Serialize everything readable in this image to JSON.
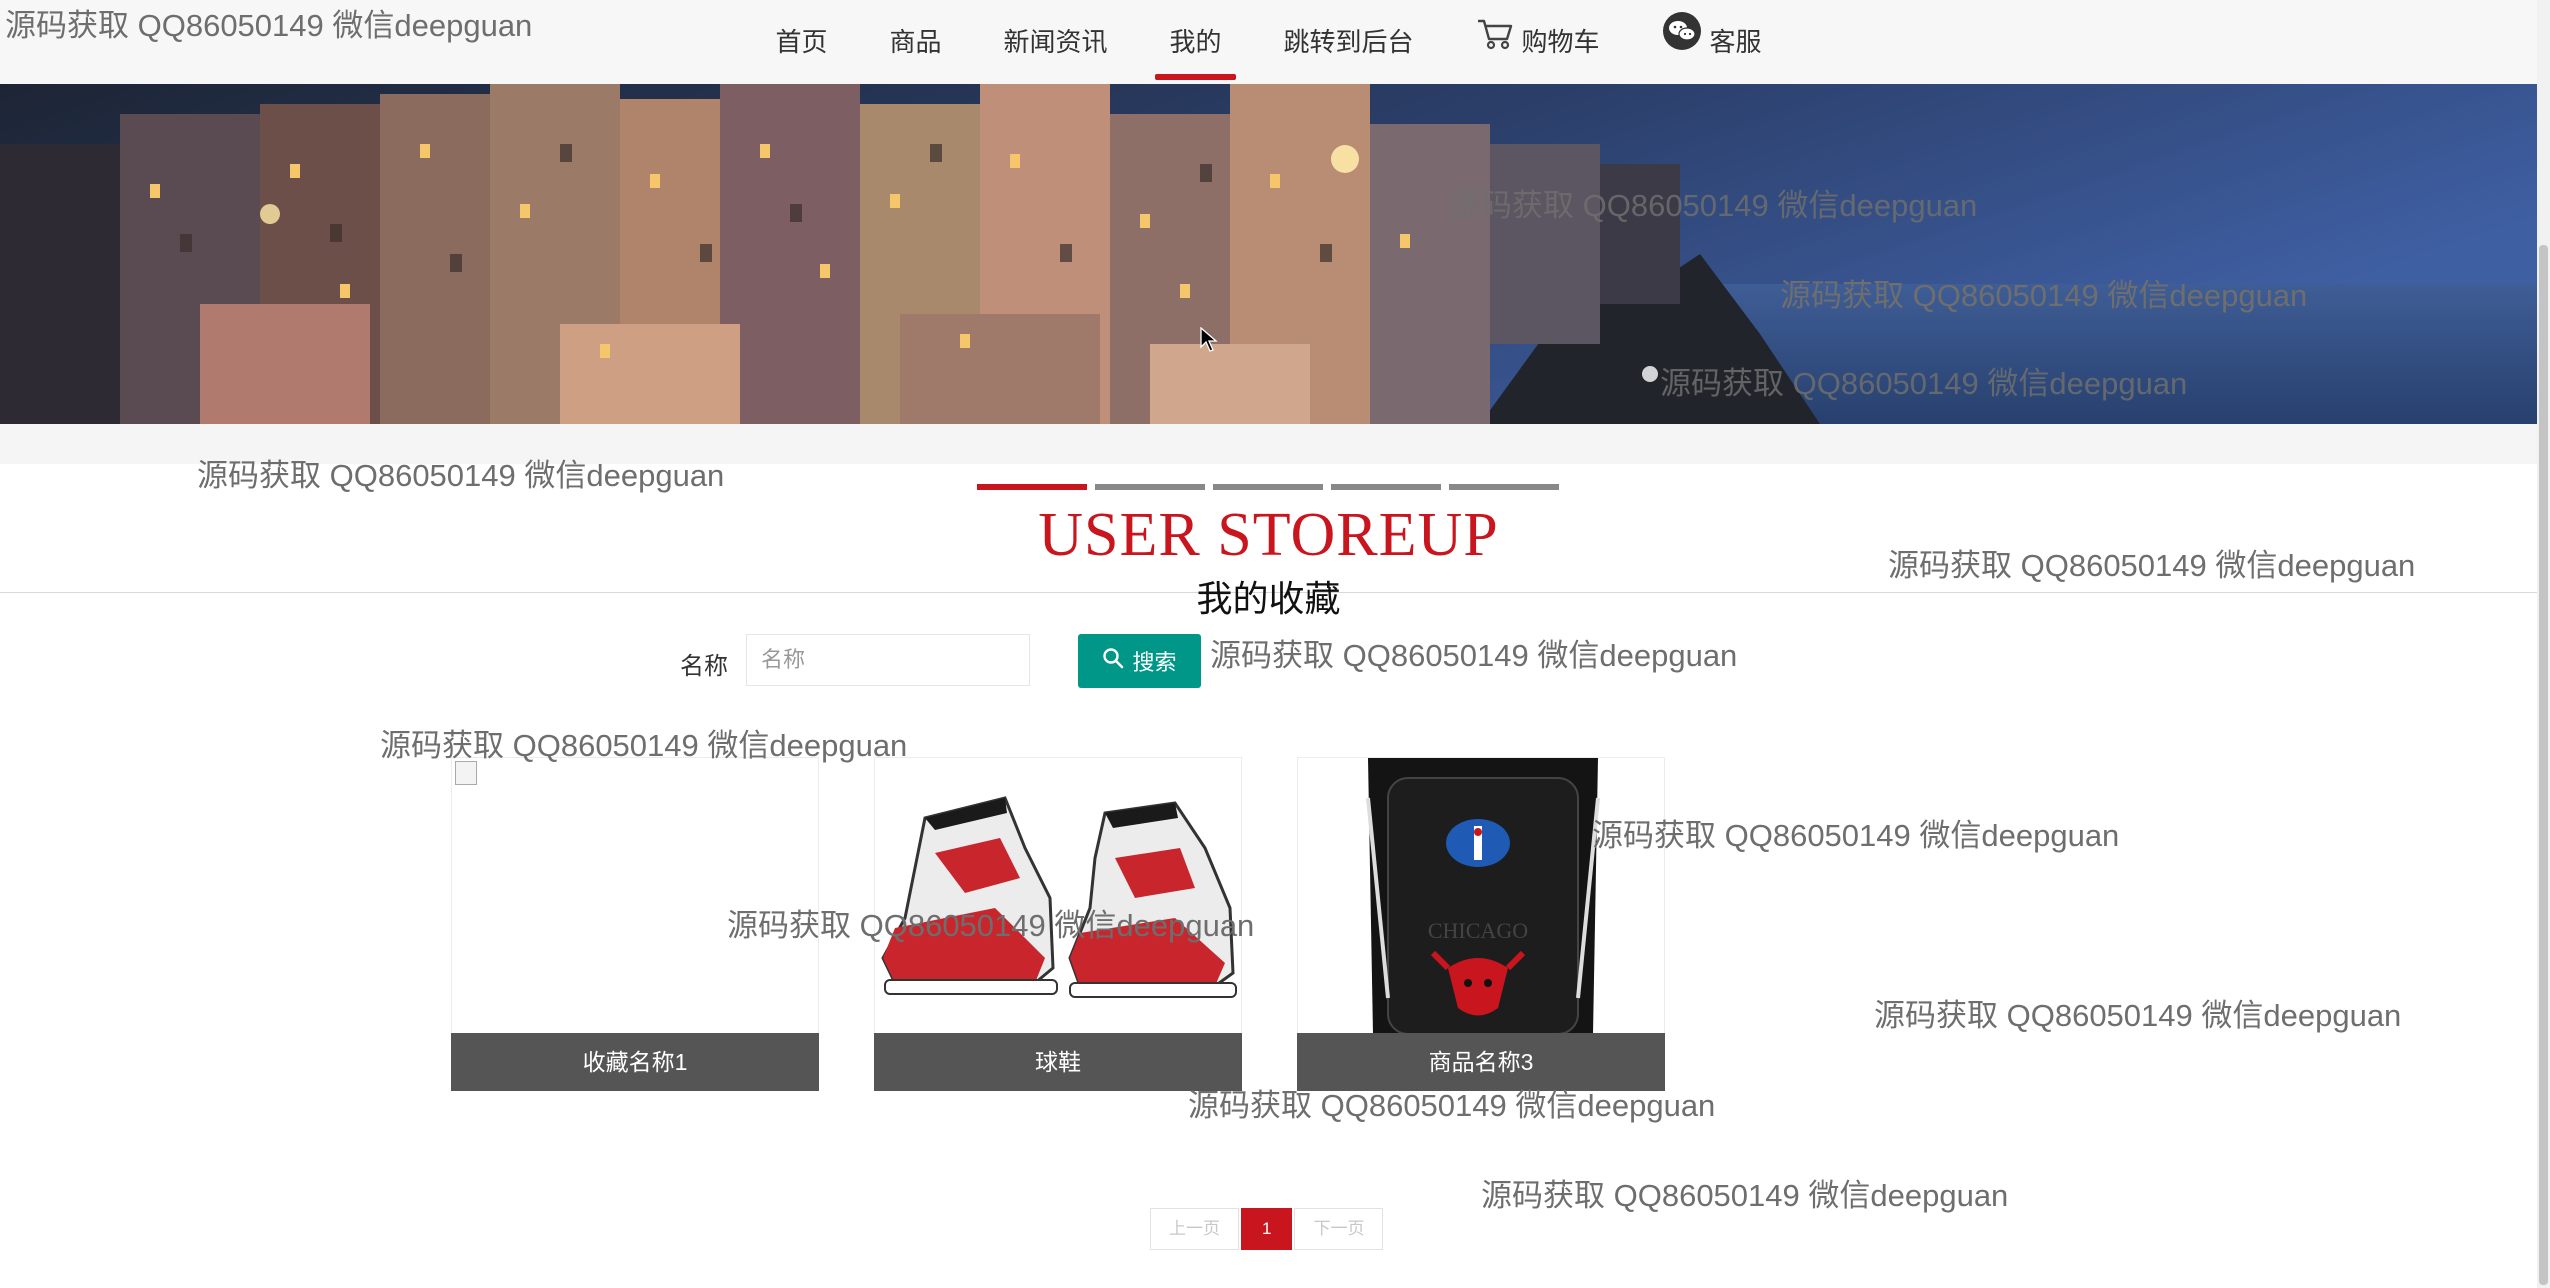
{
  "nav": {
    "items": [
      {
        "label": "首页",
        "icon": null,
        "active": false
      },
      {
        "label": "商品",
        "icon": null,
        "active": false
      },
      {
        "label": "新闻资讯",
        "icon": null,
        "active": false
      },
      {
        "label": "我的",
        "icon": null,
        "active": true
      },
      {
        "label": "跳转到后台",
        "icon": null,
        "active": false
      },
      {
        "label": "购物车",
        "icon": "cart-icon",
        "active": false
      },
      {
        "label": "客服",
        "icon": "wechat-icon",
        "active": false
      }
    ]
  },
  "banner": {
    "dots": 5,
    "active_dot": 1
  },
  "heading": {
    "title_en": "USER STOREUP",
    "title_cn": "我的收藏"
  },
  "search": {
    "label": "名称",
    "placeholder": "名称",
    "value": "",
    "button_label": "搜索"
  },
  "cards": [
    {
      "name": "收藏名称1",
      "image": "broken"
    },
    {
      "name": "球鞋",
      "image": "sneakers"
    },
    {
      "name": "商品名称3",
      "image": "backpack"
    }
  ],
  "pagination": {
    "prev": "上一页",
    "current": "1",
    "next": "下一页"
  },
  "watermark": "源码获取 QQ86050149 微信deepguan",
  "colors": {
    "accent": "#c9151e",
    "search_button": "#009688",
    "caption_bg": "#555555"
  }
}
